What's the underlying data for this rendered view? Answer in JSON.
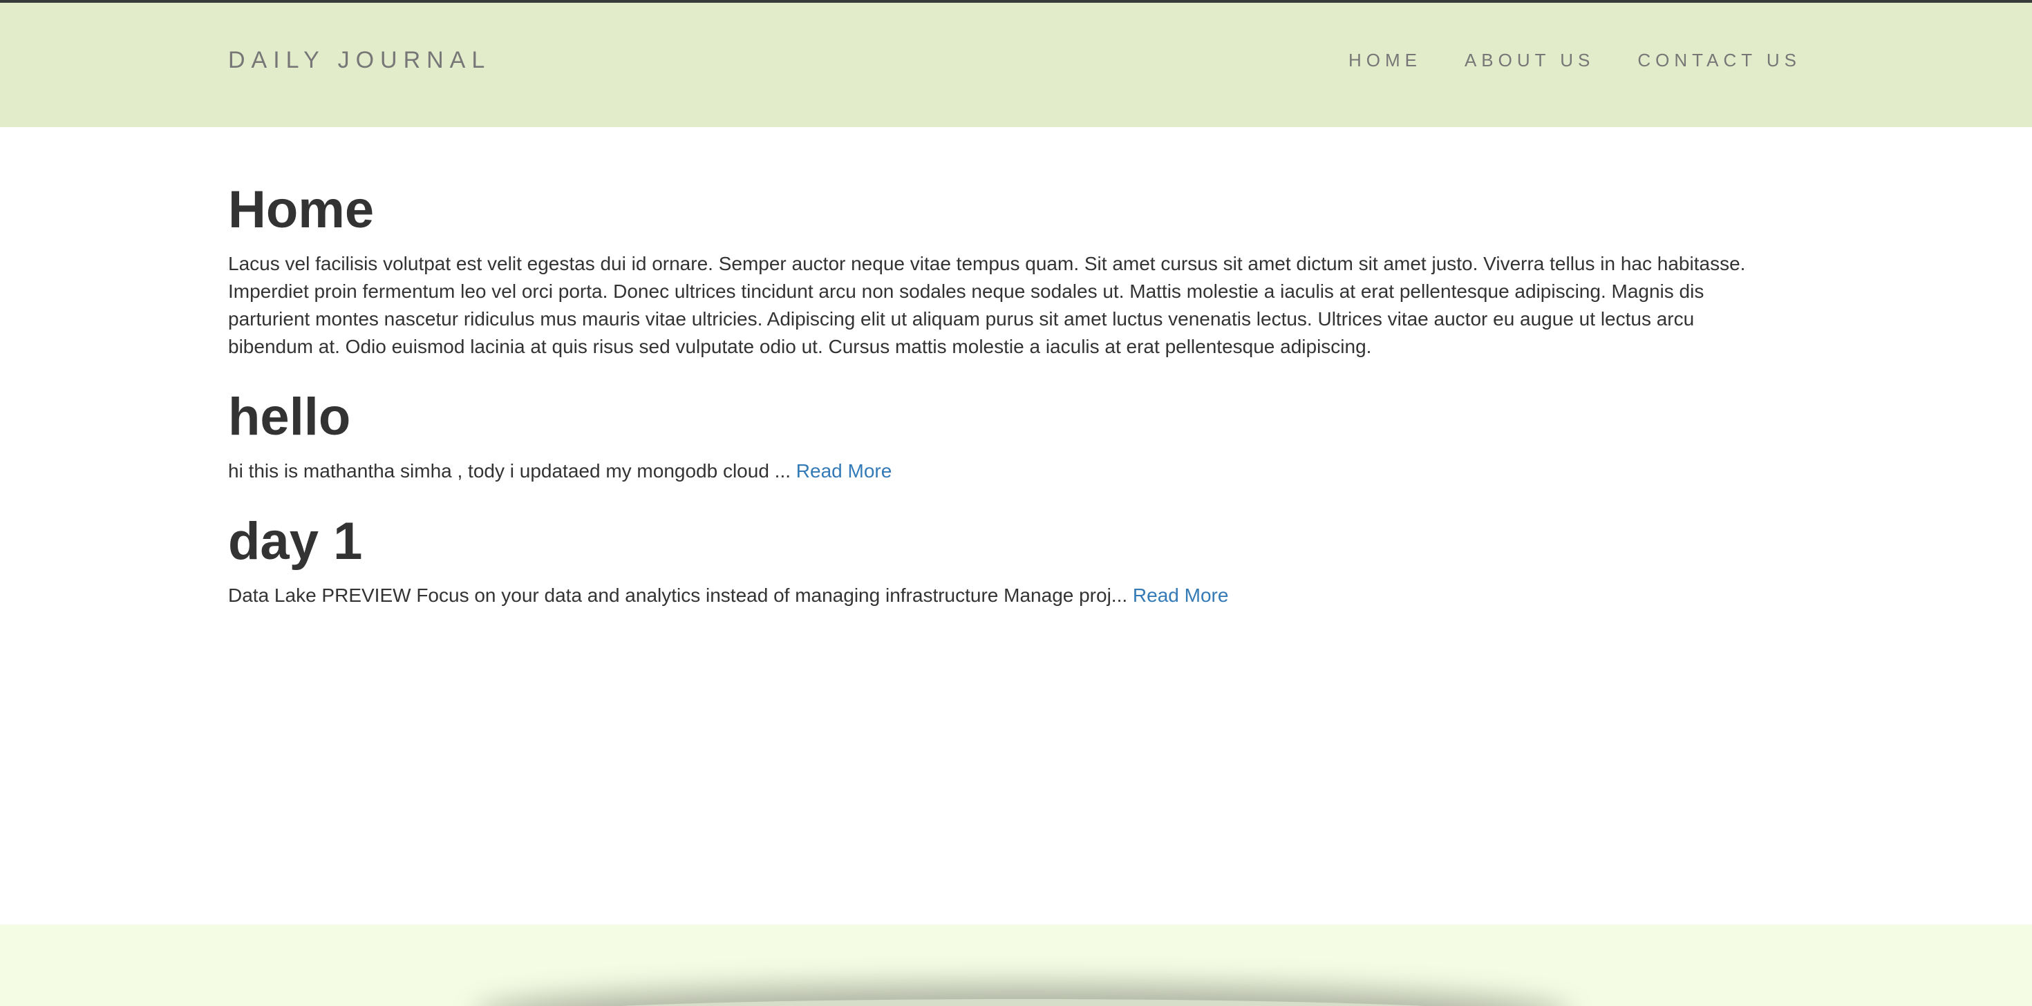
{
  "navbar": {
    "brand": "DAILY JOURNAL",
    "links": [
      {
        "label": "HOME"
      },
      {
        "label": "ABOUT US"
      },
      {
        "label": "CONTACT US"
      }
    ]
  },
  "home": {
    "title": "Home",
    "content": "Lacus vel facilisis volutpat est velit egestas dui id ornare. Semper auctor neque vitae tempus quam. Sit amet cursus sit amet dictum sit amet justo. Viverra tellus in hac habitasse. Imperdiet proin fermentum leo vel orci porta. Donec ultrices tincidunt arcu non sodales neque sodales ut. Mattis molestie a iaculis at erat pellentesque adipiscing. Magnis dis parturient montes nascetur ridiculus mus mauris vitae ultricies. Adipiscing elit ut aliquam purus sit amet luctus venenatis lectus. Ultrices vitae auctor eu augue ut lectus arcu bibendum at. Odio euismod lacinia at quis risus sed vulputate odio ut. Cursus mattis molestie a iaculis at erat pellentesque adipiscing."
  },
  "posts": [
    {
      "title": "hello",
      "excerpt": "hi this is mathantha simha , tody i updataed my mongodb cloud ... ",
      "read_more": "Read More"
    },
    {
      "title": "day 1",
      "excerpt": "Data Lake PREVIEW Focus on your data and analytics instead of managing infrastructure Manage proj... ",
      "read_more": "Read More"
    }
  ],
  "colors": {
    "navbar_bg": "#e3ecca",
    "footer_bg": "#f4fce4",
    "link": "#337ab7",
    "text": "#333333",
    "nav_text": "#777777"
  }
}
